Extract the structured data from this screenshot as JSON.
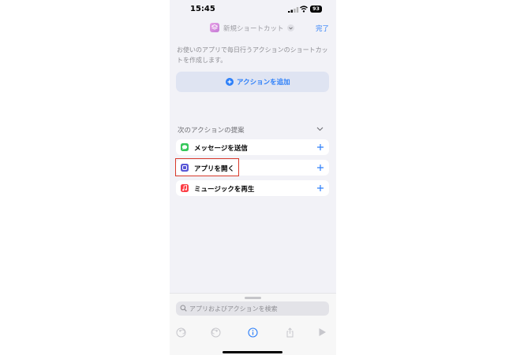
{
  "status_bar": {
    "time": "15:45",
    "battery": "93"
  },
  "nav": {
    "title": "新規ショートカット",
    "done_label": "完了"
  },
  "description": "お使いのアプリで毎日行うアクションのショートカットを作成します。",
  "add_action": {
    "label": "アクションを追加"
  },
  "suggestions": {
    "header": "次のアクションの提案",
    "items": [
      {
        "label": "メッセージを送信",
        "icon": "messages-icon",
        "color": "#34c759"
      },
      {
        "label": "アプリを開く",
        "icon": "open-app-icon",
        "color": "#5856d6"
      },
      {
        "label": "ミュージックを再生",
        "icon": "music-icon",
        "color": "#fc3c44"
      }
    ]
  },
  "search": {
    "placeholder": "アプリおよびアクションを検索"
  },
  "toolbar": {
    "icons": [
      "undo-icon",
      "redo-icon",
      "info-icon",
      "share-icon",
      "play-icon"
    ]
  },
  "colors": {
    "accent": "#2d7ff9",
    "highlight": "#d93a2b",
    "background": "#f2f2f7"
  }
}
